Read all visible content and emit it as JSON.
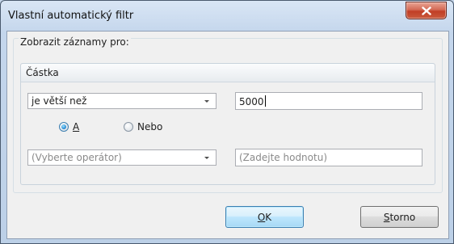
{
  "window": {
    "title": "Vlastní automatický filtr"
  },
  "group": {
    "legend": "Zobrazit záznamy pro:",
    "column": "Částka"
  },
  "row1": {
    "operator": "je větší než",
    "value": "5000"
  },
  "logic": {
    "and": {
      "accel": "A",
      "rest": "",
      "checked": true
    },
    "or": {
      "label": "Nebo",
      "checked": false
    }
  },
  "row2": {
    "operator_placeholder": "(Vyberte operátor)",
    "value_placeholder": "(Zadejte hodnotu)"
  },
  "buttons": {
    "ok": {
      "accel": "O",
      "rest": "K"
    },
    "cancel": {
      "accel": "S",
      "rest": "torno"
    }
  },
  "icons": {
    "close": "close-icon",
    "dropdown": "chevron-down-icon"
  },
  "colors": {
    "close_red": "#c13e26",
    "default_button_border": "#3c7fb1",
    "radio_blue": "#2f8fd6"
  }
}
